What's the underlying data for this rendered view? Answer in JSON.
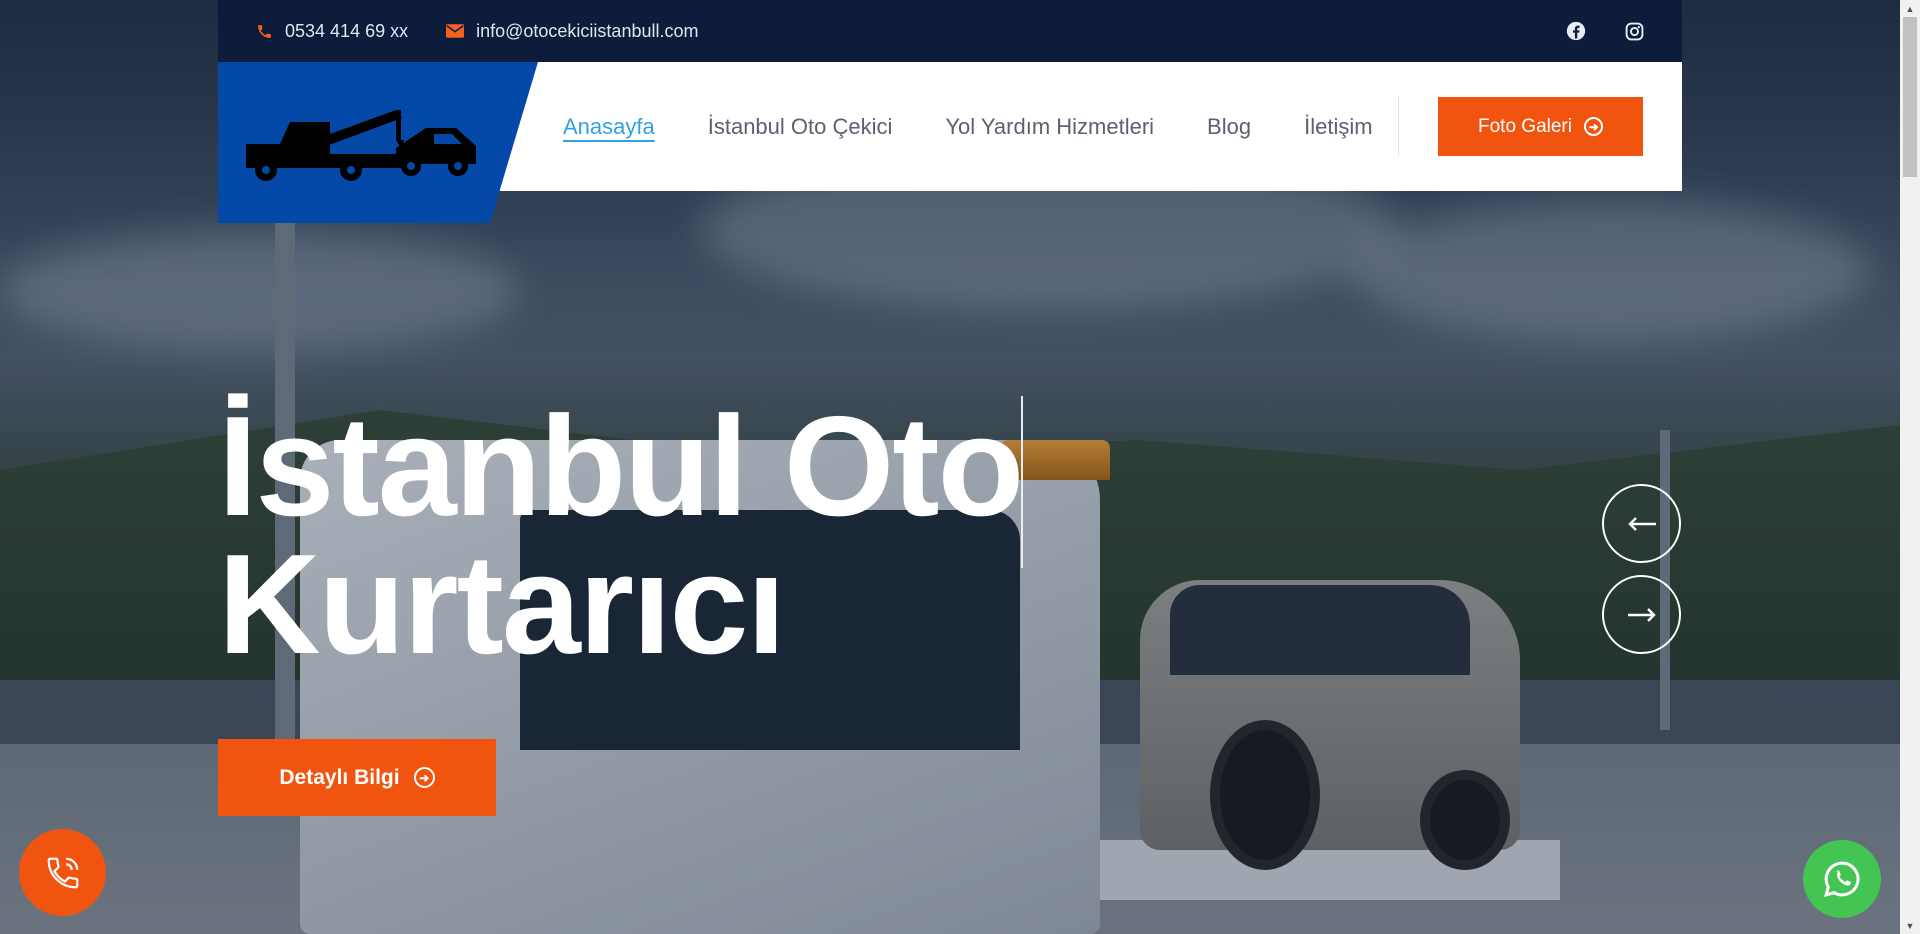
{
  "topbar": {
    "phone": "0534 414 69 xx",
    "email": "info@otocekiciistanbull.com",
    "social": [
      "facebook-icon",
      "instagram-icon"
    ]
  },
  "nav": {
    "items": [
      {
        "label": "Anasayfa",
        "active": true
      },
      {
        "label": "İstanbul Oto Çekici",
        "active": false
      },
      {
        "label": "Yol Yardım Hizmetleri",
        "active": false
      },
      {
        "label": "Blog",
        "active": false
      },
      {
        "label": "İletişim",
        "active": false
      }
    ],
    "cta_label": "Foto Galeri"
  },
  "hero": {
    "title_line1": "İstanbul Oto",
    "title_line2": "Kurtarıcı",
    "button_label": "Detaylı Bilgi",
    "prev_icon": "arrow-left-icon",
    "next_icon": "arrow-right-icon"
  },
  "colors": {
    "accent": "#f0540f",
    "brand_blue": "#0448a8",
    "topbar_bg": "#0c1c3a",
    "nav_active": "#35a0e0",
    "whatsapp": "#44c553"
  }
}
